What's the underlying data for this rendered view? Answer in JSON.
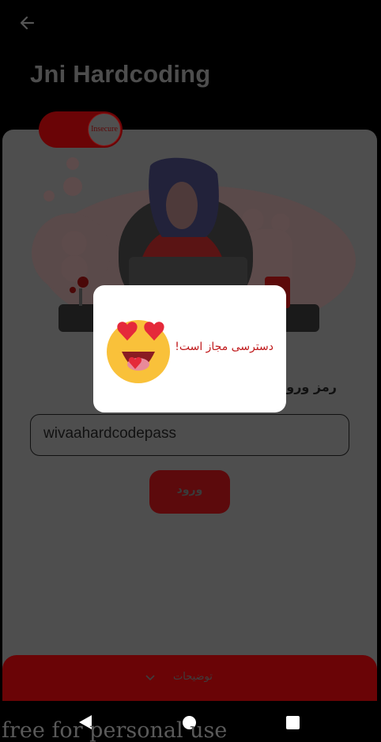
{
  "appbar": {
    "title": "Jni Hardcoding"
  },
  "toggle": {
    "label": "Insecure"
  },
  "form": {
    "password_label": "رمز ورود",
    "password_value": "wivaahardcodepass",
    "login_label": "ورود"
  },
  "footer": {
    "label": "توضیحات"
  },
  "dialog": {
    "message": "دسترسی مجاز است!"
  },
  "watermark": "free for personal use",
  "colors": {
    "accent": "#6a0406",
    "dialog_text": "#c0191b",
    "card": "#4e4e4e"
  }
}
